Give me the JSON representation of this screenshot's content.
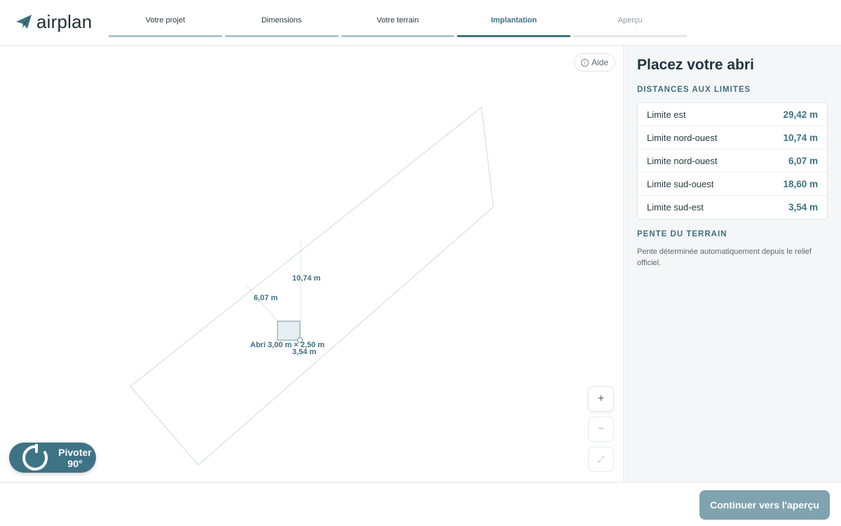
{
  "app": {
    "name": "airplan"
  },
  "steps": [
    {
      "label": "Votre projet",
      "state": "done"
    },
    {
      "label": "Dimensions",
      "state": "done"
    },
    {
      "label": "Votre terrain",
      "state": "done"
    },
    {
      "label": "Implantation",
      "state": "active"
    },
    {
      "label": "Aperçu",
      "state": "upcoming"
    }
  ],
  "map": {
    "help_label": "Aide",
    "labels": {
      "dist_north_west_2": "6,07 m",
      "dist_north_west_1": "10,74 m",
      "shed": "Abri 3,00 m × 2,50 m",
      "dist_south_east": "3,54 m"
    },
    "zoom_in": "+",
    "zoom_out": "−",
    "fit": "⤢",
    "rotate": {
      "line1": "Pivoter",
      "line2": "90°"
    }
  },
  "panel": {
    "title": "Placez votre abri",
    "distances_title": "DISTANCES AUX LIMITES",
    "distances": [
      {
        "name": "Limite est",
        "value": "29,42 m"
      },
      {
        "name": "Limite nord-ouest",
        "value": "10,74 m"
      },
      {
        "name": "Limite nord-ouest",
        "value": "6,07 m"
      },
      {
        "name": "Limite sud-ouest",
        "value": "18,60 m"
      },
      {
        "name": "Limite sud-est",
        "value": "3,54 m"
      }
    ],
    "slope_title": "PENTE DU TERRAIN",
    "slope_note": "Pente déterminée automatiquement depuis le relief officiel."
  },
  "footer": {
    "continue_label": "Continuer vers l'aperçu"
  },
  "colors": {
    "accent": "#3e7385",
    "accent_light": "#a9c3cb",
    "button_muted": "#7fa3af"
  }
}
